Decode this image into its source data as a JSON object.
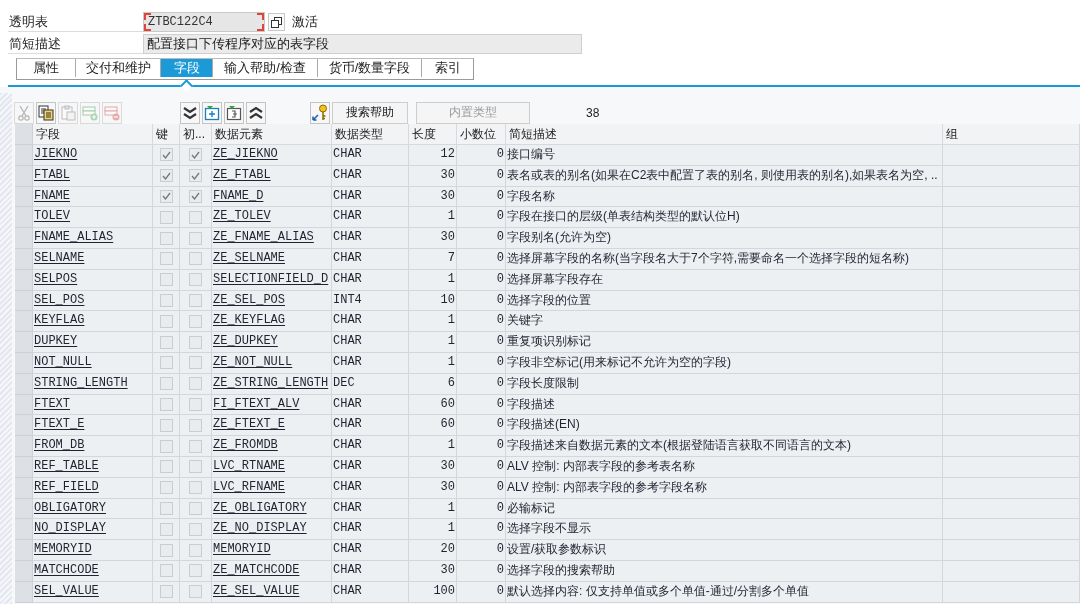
{
  "header": {
    "table_type_label": "透明表",
    "table_name": "ZTBC122C4",
    "status": "激活",
    "description_label": "简短描述",
    "description": "配置接口下传程序对应的表字段"
  },
  "tabs": [
    {
      "label": "属性",
      "selected": false
    },
    {
      "label": "交付和维护",
      "selected": false
    },
    {
      "label": "字段",
      "selected": true
    },
    {
      "label": "输入帮助/检查",
      "selected": false
    },
    {
      "label": "货币/数量字段",
      "selected": false
    },
    {
      "label": "索引",
      "selected": false
    }
  ],
  "toolbar": {
    "icon_buttons": [
      {
        "kind": "cut",
        "disabled": true
      },
      {
        "kind": "copy",
        "disabled": false
      },
      {
        "kind": "paste",
        "disabled": true
      },
      {
        "kind": "insert-row",
        "disabled": true
      },
      {
        "kind": "delete-row",
        "disabled": true
      }
    ],
    "view_buttons": [
      {
        "kind": "expand"
      },
      {
        "kind": "insert-field"
      },
      {
        "kind": "insert-include"
      },
      {
        "kind": "collapse"
      }
    ],
    "search_help_button": "搜索帮助",
    "builtin_type_button": {
      "label": "内置类型",
      "disabled": true
    },
    "count": "38"
  },
  "table": {
    "columns": [
      "字段",
      "键",
      "初...",
      "数据元素",
      "数据类型",
      "长度",
      "小数位",
      "简短描述",
      "组"
    ],
    "rows": [
      {
        "field": "JIEKNO",
        "key": true,
        "initial": true,
        "data_element": "ZE_JIEKNO",
        "data_type": "CHAR",
        "length": "12",
        "decimals": "0",
        "description": "接口编号"
      },
      {
        "field": "FTABL",
        "key": true,
        "initial": true,
        "data_element": "ZE_FTABL",
        "data_type": "CHAR",
        "length": "30",
        "decimals": "0",
        "description": "表名或表的别名(如果在C2表中配置了表的别名, 则使用表的别名),如果表名为空, .."
      },
      {
        "field": "FNAME",
        "key": true,
        "initial": true,
        "data_element": "FNAME_D",
        "data_type": "CHAR",
        "length": "30",
        "decimals": "0",
        "description": "字段名称"
      },
      {
        "field": "TOLEV",
        "key": false,
        "initial": false,
        "data_element": "ZE_TOLEV",
        "data_type": "CHAR",
        "length": "1",
        "decimals": "0",
        "description": "字段在接口的层级(单表结构类型的默认位H)"
      },
      {
        "field": "FNAME_ALIAS",
        "key": false,
        "initial": false,
        "data_element": "ZE_FNAME_ALIAS",
        "data_type": "CHAR",
        "length": "30",
        "decimals": "0",
        "description": "字段别名(允许为空)"
      },
      {
        "field": "SELNAME",
        "key": false,
        "initial": false,
        "data_element": "ZE_SELNAME",
        "data_type": "CHAR",
        "length": "7",
        "decimals": "0",
        "description": "选择屏幕字段的名称(当字段名大于7个字符,需要命名一个选择字段的短名称)"
      },
      {
        "field": "SELPOS",
        "key": false,
        "initial": false,
        "data_element": "SELECTIONFIELD_D",
        "data_type": "CHAR",
        "length": "1",
        "decimals": "0",
        "description": "选择屏幕字段存在"
      },
      {
        "field": "SEL_POS",
        "key": false,
        "initial": false,
        "data_element": "ZE_SEL_POS",
        "data_type": "INT4",
        "length": "10",
        "decimals": "0",
        "description": "选择字段的位置"
      },
      {
        "field": "KEYFLAG",
        "key": false,
        "initial": false,
        "data_element": "ZE_KEYFLAG",
        "data_type": "CHAR",
        "length": "1",
        "decimals": "0",
        "description": "关键字"
      },
      {
        "field": "DUPKEY",
        "key": false,
        "initial": false,
        "data_element": "ZE_DUPKEY",
        "data_type": "CHAR",
        "length": "1",
        "decimals": "0",
        "description": "重复项识别标记"
      },
      {
        "field": "NOT_NULL",
        "key": false,
        "initial": false,
        "data_element": "ZE_NOT_NULL",
        "data_type": "CHAR",
        "length": "1",
        "decimals": "0",
        "description": "字段非空标记(用来标记不允许为空的字段)"
      },
      {
        "field": "STRING_LENGTH",
        "key": false,
        "initial": false,
        "data_element": "ZE_STRING_LENGTH",
        "data_type": "DEC",
        "length": "6",
        "decimals": "0",
        "description": "字段长度限制"
      },
      {
        "field": "FTEXT",
        "key": false,
        "initial": false,
        "data_element": "FI_FTEXT_ALV",
        "data_type": "CHAR",
        "length": "60",
        "decimals": "0",
        "description": "字段描述"
      },
      {
        "field": "FTEXT_E",
        "key": false,
        "initial": false,
        "data_element": "ZE_FTEXT_E",
        "data_type": "CHAR",
        "length": "60",
        "decimals": "0",
        "description": "字段描述(EN)"
      },
      {
        "field": "FROM_DB",
        "key": false,
        "initial": false,
        "data_element": "ZE_FROMDB",
        "data_type": "CHAR",
        "length": "1",
        "decimals": "0",
        "description": "字段描述来自数据元素的文本(根据登陆语言获取不同语言的文本)"
      },
      {
        "field": "REF_TABLE",
        "key": false,
        "initial": false,
        "data_element": "LVC_RTNAME",
        "data_type": "CHAR",
        "length": "30",
        "decimals": "0",
        "description": "ALV 控制: 内部表字段的参考表名称"
      },
      {
        "field": "REF_FIELD",
        "key": false,
        "initial": false,
        "data_element": "LVC_RFNAME",
        "data_type": "CHAR",
        "length": "30",
        "decimals": "0",
        "description": "ALV 控制: 内部表字段的参考字段名称"
      },
      {
        "field": "OBLIGATORY",
        "key": false,
        "initial": false,
        "data_element": "ZE_OBLIGATORY",
        "data_type": "CHAR",
        "length": "1",
        "decimals": "0",
        "description": "必输标记"
      },
      {
        "field": "NO_DISPLAY",
        "key": false,
        "initial": false,
        "data_element": "ZE_NO_DISPLAY",
        "data_type": "CHAR",
        "length": "1",
        "decimals": "0",
        "description": "选择字段不显示"
      },
      {
        "field": "MEMORYID",
        "key": false,
        "initial": false,
        "data_element": "MEMORYID",
        "data_type": "CHAR",
        "length": "20",
        "decimals": "0",
        "description": "设置/获取参数标识"
      },
      {
        "field": "MATCHCODE",
        "key": false,
        "initial": false,
        "data_element": "ZE_MATCHCODE",
        "data_type": "CHAR",
        "length": "30",
        "decimals": "0",
        "description": "选择字段的搜索帮助"
      },
      {
        "field": "SEL_VALUE",
        "key": false,
        "initial": false,
        "data_element": "ZE_SEL_VALUE",
        "data_type": "CHAR",
        "length": "100",
        "decimals": "0",
        "description": "默认选择内容: 仅支持单值或多个单值-通过/分割多个单值"
      }
    ]
  }
}
